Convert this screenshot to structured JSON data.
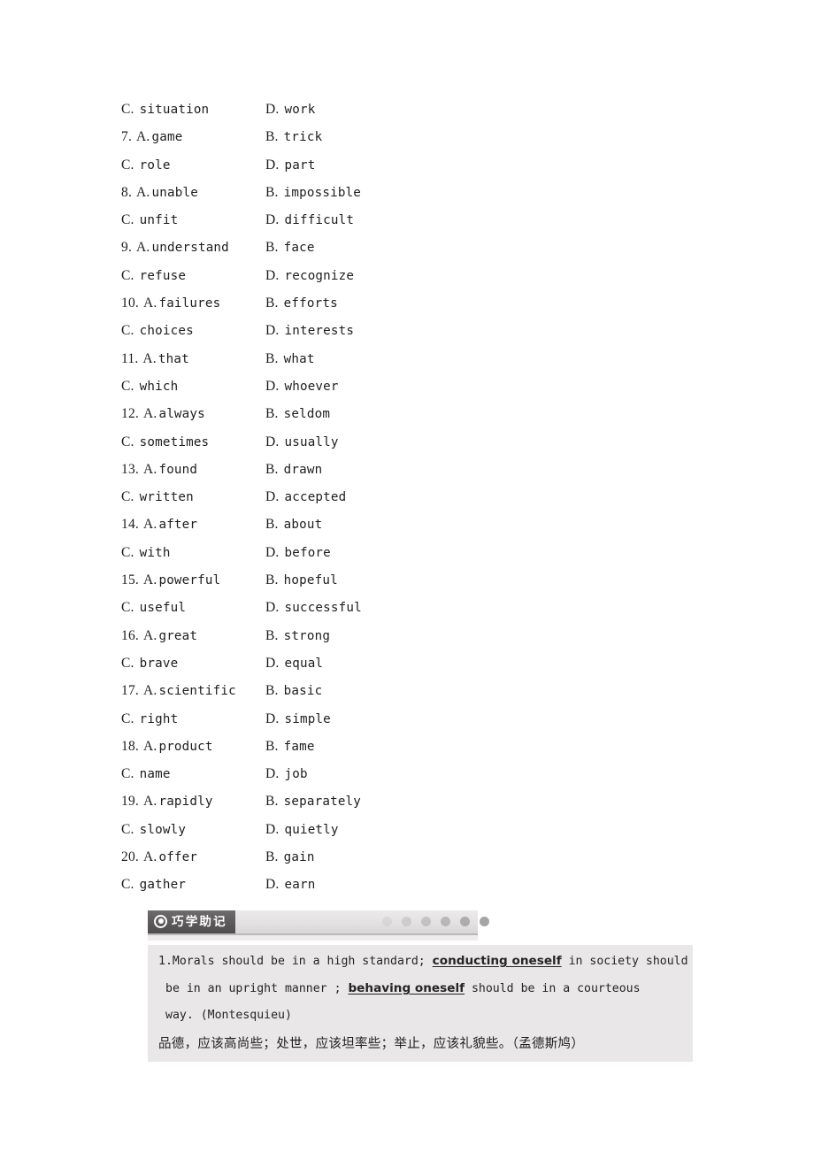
{
  "options": [
    {
      "num": "",
      "a_letter": "C.",
      "a_word": "situation",
      "b_letter": "D.",
      "b_word": "work"
    },
    {
      "num": "7.",
      "a_letter": "A.",
      "a_word": "game",
      "b_letter": "B.",
      "b_word": "trick"
    },
    {
      "num": "",
      "a_letter": "C.",
      "a_word": "role",
      "b_letter": "D.",
      "b_word": "part"
    },
    {
      "num": "8.",
      "a_letter": "A.",
      "a_word": "unable",
      "b_letter": "B.",
      "b_word": "impossible"
    },
    {
      "num": "",
      "a_letter": "C.",
      "a_word": "unfit",
      "b_letter": "D.",
      "b_word": "difficult"
    },
    {
      "num": "9.",
      "a_letter": "A.",
      "a_word": "understand",
      "b_letter": "B.",
      "b_word": "face"
    },
    {
      "num": "",
      "a_letter": "C.",
      "a_word": "refuse",
      "b_letter": "D.",
      "b_word": "recognize"
    },
    {
      "num": "10.",
      "a_letter": "A.",
      "a_word": "failures",
      "b_letter": "B.",
      "b_word": "efforts"
    },
    {
      "num": "",
      "a_letter": "C.",
      "a_word": "choices",
      "b_letter": "D.",
      "b_word": "interests"
    },
    {
      "num": "11.",
      "a_letter": "A.",
      "a_word": "that",
      "b_letter": "B.",
      "b_word": "what"
    },
    {
      "num": "",
      "a_letter": "C.",
      "a_word": "which",
      "b_letter": "D.",
      "b_word": "whoever"
    },
    {
      "num": "12.",
      "a_letter": "A.",
      "a_word": "always",
      "b_letter": "B.",
      "b_word": "seldom"
    },
    {
      "num": "",
      "a_letter": "C.",
      "a_word": "sometimes",
      "b_letter": "D.",
      "b_word": "usually"
    },
    {
      "num": "13.",
      "a_letter": "A.",
      "a_word": "found",
      "b_letter": "B.",
      "b_word": "drawn"
    },
    {
      "num": "",
      "a_letter": "C.",
      "a_word": "written",
      "b_letter": "D.",
      "b_word": "accepted"
    },
    {
      "num": "14.",
      "a_letter": "A.",
      "a_word": "after",
      "b_letter": "B.",
      "b_word": "about"
    },
    {
      "num": "",
      "a_letter": "C.",
      "a_word": "with",
      "b_letter": "D.",
      "b_word": "before"
    },
    {
      "num": "15.",
      "a_letter": "A.",
      "a_word": "powerful",
      "b_letter": "B.",
      "b_word": "hopeful"
    },
    {
      "num": "",
      "a_letter": "C.",
      "a_word": "useful",
      "b_letter": "D.",
      "b_word": "successful"
    },
    {
      "num": "16.",
      "a_letter": "A.",
      "a_word": "great",
      "b_letter": "B.",
      "b_word": "strong"
    },
    {
      "num": "",
      "a_letter": "C.",
      "a_word": "brave",
      "b_letter": "D.",
      "b_word": "equal"
    },
    {
      "num": "17.",
      "a_letter": "A.",
      "a_word": "scientific",
      "b_letter": "B.",
      "b_word": "basic"
    },
    {
      "num": "",
      "a_letter": "C.",
      "a_word": "right",
      "b_letter": "D.",
      "b_word": "simple"
    },
    {
      "num": "18.",
      "a_letter": "A.",
      "a_word": "product",
      "b_letter": "B.",
      "b_word": "fame"
    },
    {
      "num": "",
      "a_letter": "C.",
      "a_word": "name",
      "b_letter": "D.",
      "b_word": "job"
    },
    {
      "num": "19.",
      "a_letter": "A.",
      "a_word": "rapidly",
      "b_letter": "B.",
      "b_word": "separately"
    },
    {
      "num": "",
      "a_letter": "C.",
      "a_word": "slowly",
      "b_letter": "D.",
      "b_word": "quietly"
    },
    {
      "num": "20.",
      "a_letter": "A.",
      "a_word": "offer",
      "b_letter": "B.",
      "b_word": "gain"
    },
    {
      "num": "",
      "a_letter": "C.",
      "a_word": "gather",
      "b_letter": "D.",
      "b_word": "earn"
    }
  ],
  "section": {
    "tab_label": "巧学助记",
    "bullet_icon": "filled-circle-icon",
    "dot_count": 6,
    "dot_color": "#9d9b9b",
    "tab_bg": "#5d5b5b",
    "bar_bg": "#e3e1e1"
  },
  "quote": {
    "background": "#e9e7e7",
    "number": "1.",
    "line1_pre": "Morals should be in a high standard",
    "line1_sep": "; ",
    "line1_kw": "conducting oneself",
    "line1_post": " in society should",
    "line2_pre": "be  in  an  upright  manner",
    "line2_sep": " ; ",
    "line2_kw": "behaving  oneself",
    "line2_post": "  should  be  in  a  courteous",
    "line3": "way. (Montesquieu)",
    "line4": "品德，应该高尚些；处世，应该坦率些；举止，应该礼貌些。（孟德斯鸠）"
  }
}
